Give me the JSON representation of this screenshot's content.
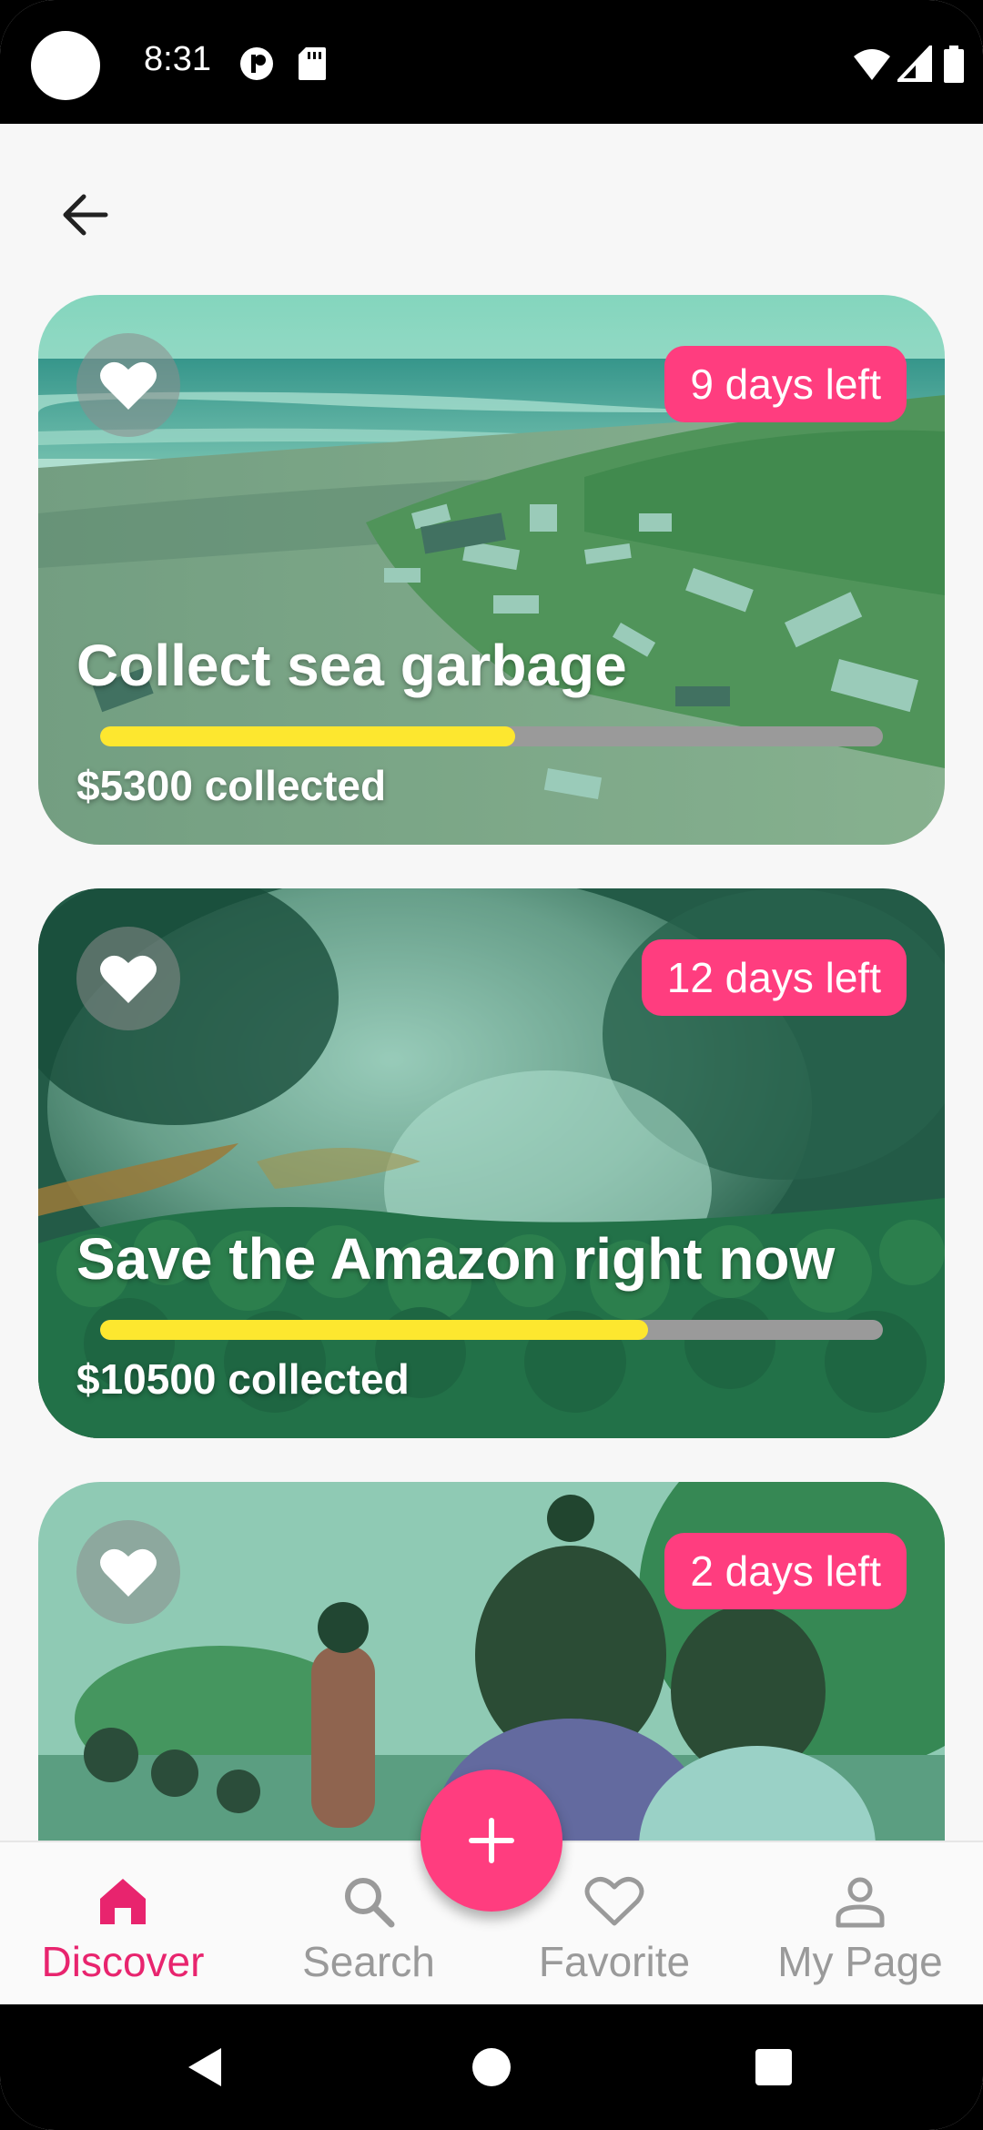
{
  "status_bar": {
    "time": "8:31",
    "icons": [
      "camera-icon",
      "notification-icon",
      "sd-card-icon",
      "wifi-icon",
      "signal-icon",
      "battery-icon"
    ]
  },
  "header": {
    "back_icon": "arrow-left-icon"
  },
  "cards": [
    {
      "title": "Collect sea garbage",
      "days_left": "9 days left",
      "collected": "$5300 collected",
      "progress": 0.53
    },
    {
      "title": "Save the Amazon right now",
      "days_left": "12 days left",
      "collected": "$10500 collected",
      "progress": 0.7
    },
    {
      "days_left": "2 days left"
    }
  ],
  "bottom_nav": {
    "items": [
      {
        "label": "Discover",
        "icon": "home-icon",
        "active": true
      },
      {
        "label": "Search",
        "icon": "search-icon",
        "active": false
      },
      {
        "label": "Favorite",
        "icon": "heart-icon",
        "active": false
      },
      {
        "label": "My Page",
        "icon": "person-icon",
        "active": false
      }
    ],
    "fab_icon": "plus-icon"
  },
  "colors": {
    "accent": "#ff3d7f",
    "active_nav": "#e8246e",
    "progress_fill": "#fde72f",
    "progress_track": "#9a9a9a"
  }
}
